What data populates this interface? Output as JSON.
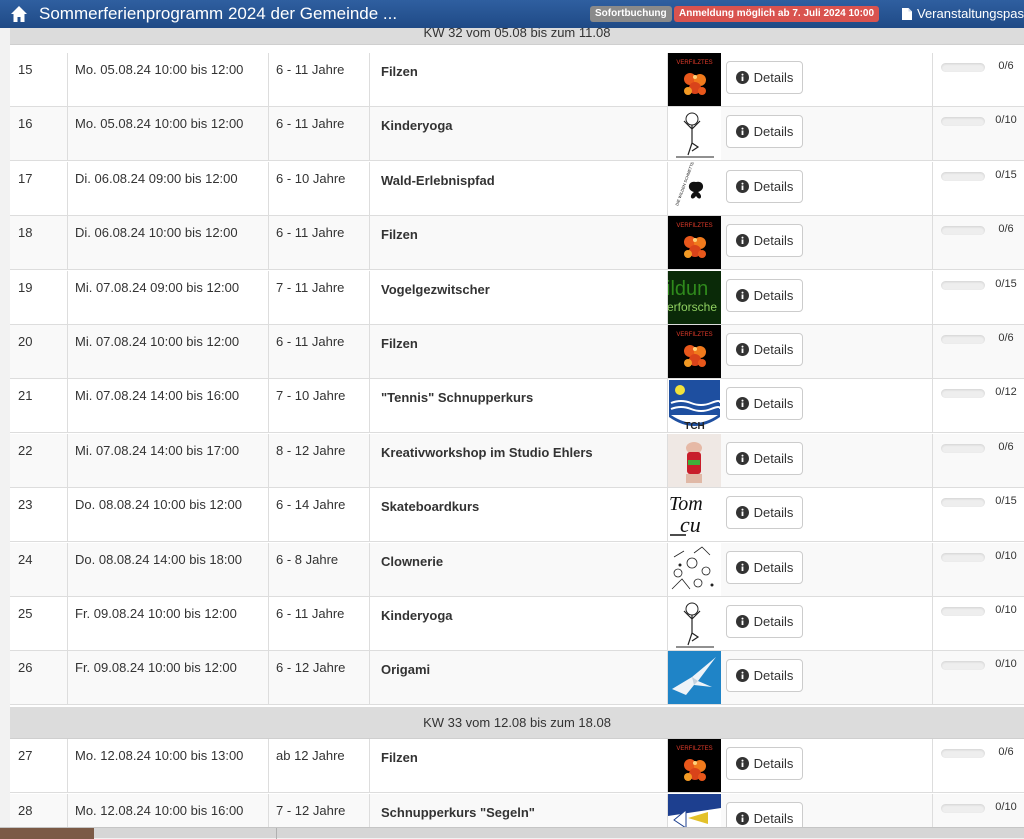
{
  "navbar": {
    "title": "Sommerferienprogramm 2024 der Gemeinde ...",
    "badge_instant": "Sofortbuchung",
    "badge_registration": "Anmeldung möglich ab 7. Juli 2024 10:00",
    "pass_link": "Veranstaltungspass"
  },
  "details_label": "Details",
  "weeks": [
    {
      "label": "KW 32 vom 05.08 bis zum 11.08"
    },
    {
      "label": "KW 33 vom 12.08 bis zum 18.08"
    }
  ],
  "rows": [
    {
      "num": "15",
      "date": "Mo. 05.08.24 10:00 bis 12:00",
      "age": "6 - 11 Jahre",
      "title": "Filzen",
      "thumb": "filzen",
      "capacity": "0/6",
      "fill": 0
    },
    {
      "num": "16",
      "date": "Mo. 05.08.24 10:00 bis 12:00",
      "age": "6 - 11 Jahre",
      "title": "Kinderyoga",
      "thumb": "yoga",
      "capacity": "0/10",
      "fill": 0
    },
    {
      "num": "17",
      "date": "Di. 06.08.24 09:00 bis 12:00",
      "age": "6 - 10 Jahre",
      "title": "Wald-Erlebnispfad",
      "thumb": "wald",
      "capacity": "0/15",
      "fill": 0
    },
    {
      "num": "18",
      "date": "Di. 06.08.24 10:00 bis 12:00",
      "age": "6 - 11 Jahre",
      "title": "Filzen",
      "thumb": "filzen",
      "capacity": "0/6",
      "fill": 0
    },
    {
      "num": "19",
      "date": "Mi. 07.08.24 09:00 bis 12:00",
      "age": "7 - 11 Jahre",
      "title": "Vogelgezwitscher",
      "thumb": "vogel",
      "capacity": "0/15",
      "fill": 0
    },
    {
      "num": "20",
      "date": "Mi. 07.08.24 10:00 bis 12:00",
      "age": "6 - 11 Jahre",
      "title": "Filzen",
      "thumb": "filzen",
      "capacity": "0/6",
      "fill": 0
    },
    {
      "num": "21",
      "date": "Mi. 07.08.24 14:00 bis 16:00",
      "age": "7 - 10 Jahre",
      "title": "\"Tennis\" Schnupperkurs",
      "thumb": "tch",
      "capacity": "0/12",
      "fill": 0
    },
    {
      "num": "22",
      "date": "Mi. 07.08.24 14:00 bis 17:00",
      "age": "8 - 12 Jahre",
      "title": "Kreativworkshop im Studio Ehlers",
      "thumb": "kreativ",
      "capacity": "0/6",
      "fill": 0
    },
    {
      "num": "23",
      "date": "Do. 08.08.24 10:00 bis 12:00",
      "age": "6 - 14 Jahre",
      "title": "Skateboardkurs",
      "thumb": "skate",
      "capacity": "0/15",
      "fill": 0
    },
    {
      "num": "24",
      "date": "Do. 08.08.24 14:00 bis 18:00",
      "age": "6 - 8 Jahre",
      "title": "Clownerie",
      "thumb": "clown",
      "capacity": "0/10",
      "fill": 0
    },
    {
      "num": "25",
      "date": "Fr. 09.08.24 10:00 bis 12:00",
      "age": "6 - 11 Jahre",
      "title": "Kinderyoga",
      "thumb": "yoga",
      "capacity": "0/10",
      "fill": 0
    },
    {
      "num": "26",
      "date": "Fr. 09.08.24 10:00 bis 12:00",
      "age": "6 - 12 Jahre",
      "title": "Origami",
      "thumb": "origami",
      "capacity": "0/10",
      "fill": 0
    },
    {
      "num": "27",
      "date": "Mo. 12.08.24 10:00 bis 13:00",
      "age": "ab 12 Jahre",
      "title": "Filzen",
      "thumb": "filzen",
      "capacity": "0/6",
      "fill": 0
    },
    {
      "num": "28",
      "date": "Mo. 12.08.24 10:00 bis 16:00",
      "age": "7 - 12 Jahre",
      "title": "Schnupperkurs \"Segeln\"",
      "thumb": "segeln",
      "capacity": "0/10",
      "fill": 0
    }
  ],
  "thumb_texts": {
    "filzen": "VERFILZTES",
    "vogel_a": "ildun",
    "vogel_b": "erforsche",
    "tch": "TCH",
    "skate_a": "Tom",
    "skate_b": "cu",
    "wald": "DIE WILDEN SCHMETTERLINGE"
  },
  "colors": {
    "navbar": "#1f4a86",
    "badge_grey": "#8a8a8a",
    "badge_red": "#d9534f",
    "week_bg": "#dcdcdc"
  }
}
